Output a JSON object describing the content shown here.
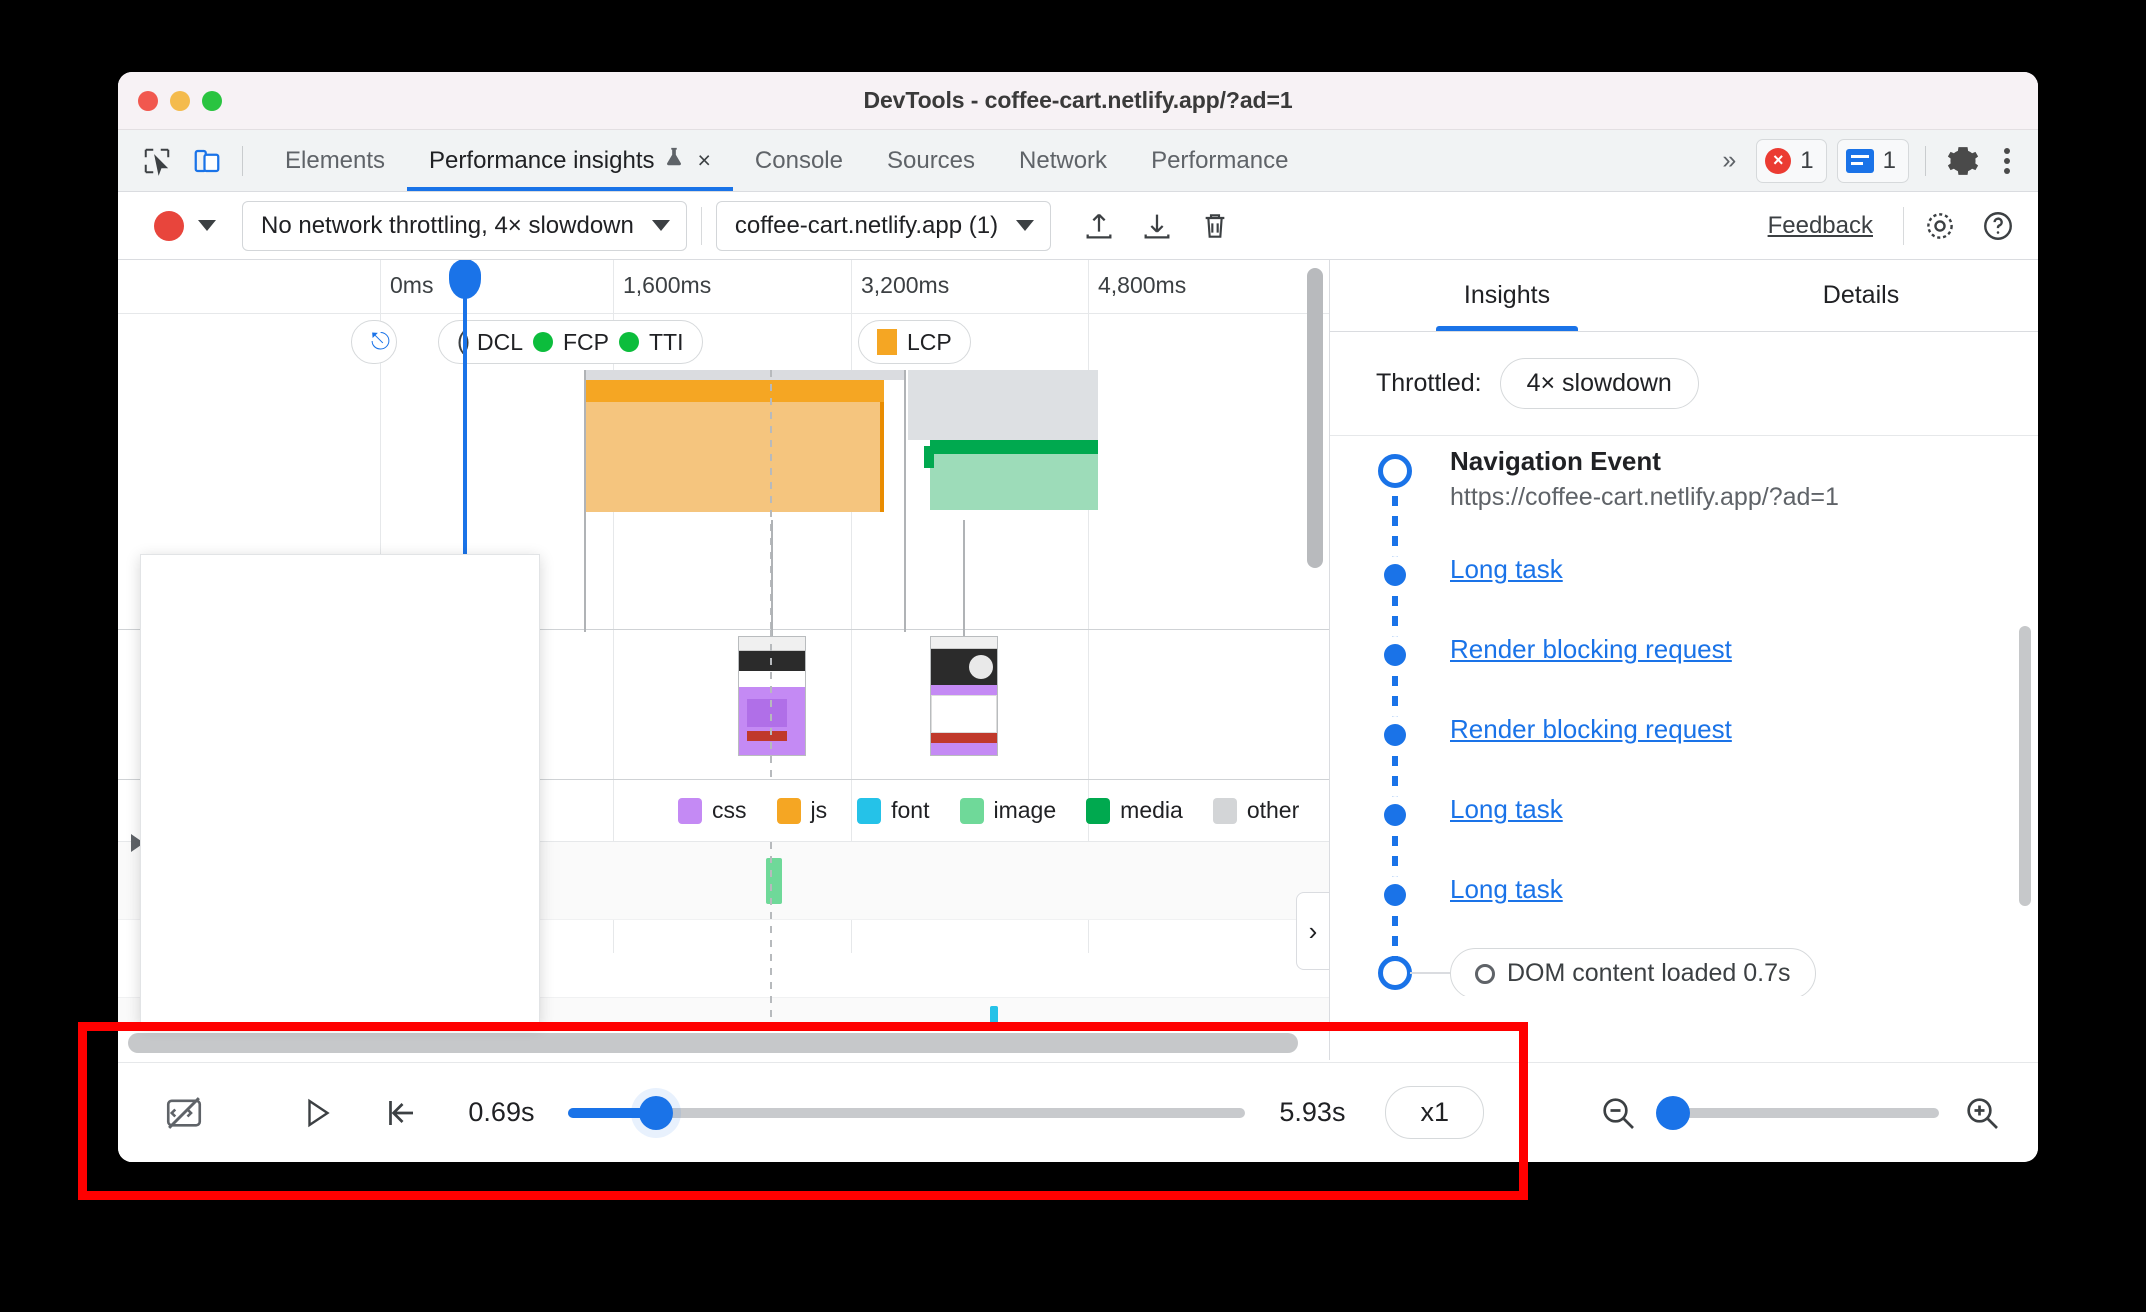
{
  "window": {
    "title": "DevTools - coffee-cart.netlify.app/?ad=1",
    "traffic_lights": [
      "close",
      "minimize",
      "maximize"
    ]
  },
  "tabbar": {
    "inspect_icon": "inspect-cursor-icon",
    "device_icon": "device-toolbar-icon",
    "tabs": [
      {
        "label": "Elements",
        "active": false
      },
      {
        "label": "Performance insights",
        "active": true,
        "experimental": true,
        "closable": true,
        "close_label": "×"
      },
      {
        "label": "Console",
        "active": false
      },
      {
        "label": "Sources",
        "active": false
      },
      {
        "label": "Network",
        "active": false
      },
      {
        "label": "Performance",
        "active": false
      }
    ],
    "more_tabs": "»",
    "error_count": "1",
    "message_count": "1",
    "settings_icon": "gear-icon",
    "more_icon": "kebab-menu-icon"
  },
  "toolbar": {
    "record_button": "record-button",
    "record_dropdown": "record-options-dropdown",
    "throttling_value": "No network throttling, 4× slowdown",
    "page_value": "coffee-cart.netlify.app (1)",
    "upload_icon": "upload-icon",
    "download_icon": "download-icon",
    "delete_icon": "trash-icon",
    "feedback_label": "Feedback",
    "settings_icon": "gear-icon",
    "help_icon": "help-icon"
  },
  "timeline": {
    "ticks": [
      "0ms",
      "1,600ms",
      "3,200ms",
      "4,800ms"
    ],
    "markers": [
      {
        "label": "DCL",
        "color": "#3c4043",
        "shape": "parens"
      },
      {
        "label": "FCP",
        "color": "#0cbd3c",
        "shape": "dot"
      },
      {
        "label": "TTI",
        "color": "#0cbd3c",
        "shape": "dot"
      },
      {
        "label": "LCP",
        "color": "#f5a623",
        "shape": "square"
      }
    ],
    "legend": [
      {
        "label": "css",
        "color": "#c48af4"
      },
      {
        "label": "js",
        "color": "#f5a623"
      },
      {
        "label": "font",
        "color": "#25c2e8"
      },
      {
        "label": "image",
        "color": "#6fd999"
      },
      {
        "label": "media",
        "color": "#00a94f"
      },
      {
        "label": "other",
        "color": "#d3d5d7"
      }
    ],
    "expand_icon": "expand-triangle-icon",
    "side_toggle_icon": "chevron-right-icon"
  },
  "sidebar": {
    "tabs": [
      {
        "label": "Insights",
        "active": true
      },
      {
        "label": "Details",
        "active": false
      }
    ],
    "throttled_label": "Throttled:",
    "throttled_value": "4× slowdown",
    "navigation": {
      "title": "Navigation Event",
      "url": "https://coffee-cart.netlify.app/?ad=1"
    },
    "items": [
      {
        "label": "Long task"
      },
      {
        "label": "Render blocking request"
      },
      {
        "label": "Render blocking request"
      },
      {
        "label": "Long task"
      },
      {
        "label": "Long task"
      }
    ],
    "dom_event": "DOM content loaded 0.7s"
  },
  "controls": {
    "screenshot_toggle_icon": "screenshot-off-icon",
    "play_icon": "play-icon",
    "reset_icon": "jump-to-start-icon",
    "time_start": "0.69s",
    "time_end": "5.93s",
    "playback_progress_pct": 13,
    "speed_label": "x1",
    "zoom_out_icon": "zoom-out-icon",
    "zoom_in_icon": "zoom-in-icon",
    "zoom_level_pct": 4
  },
  "annotation": {
    "highlight_color": "#ff0000"
  }
}
